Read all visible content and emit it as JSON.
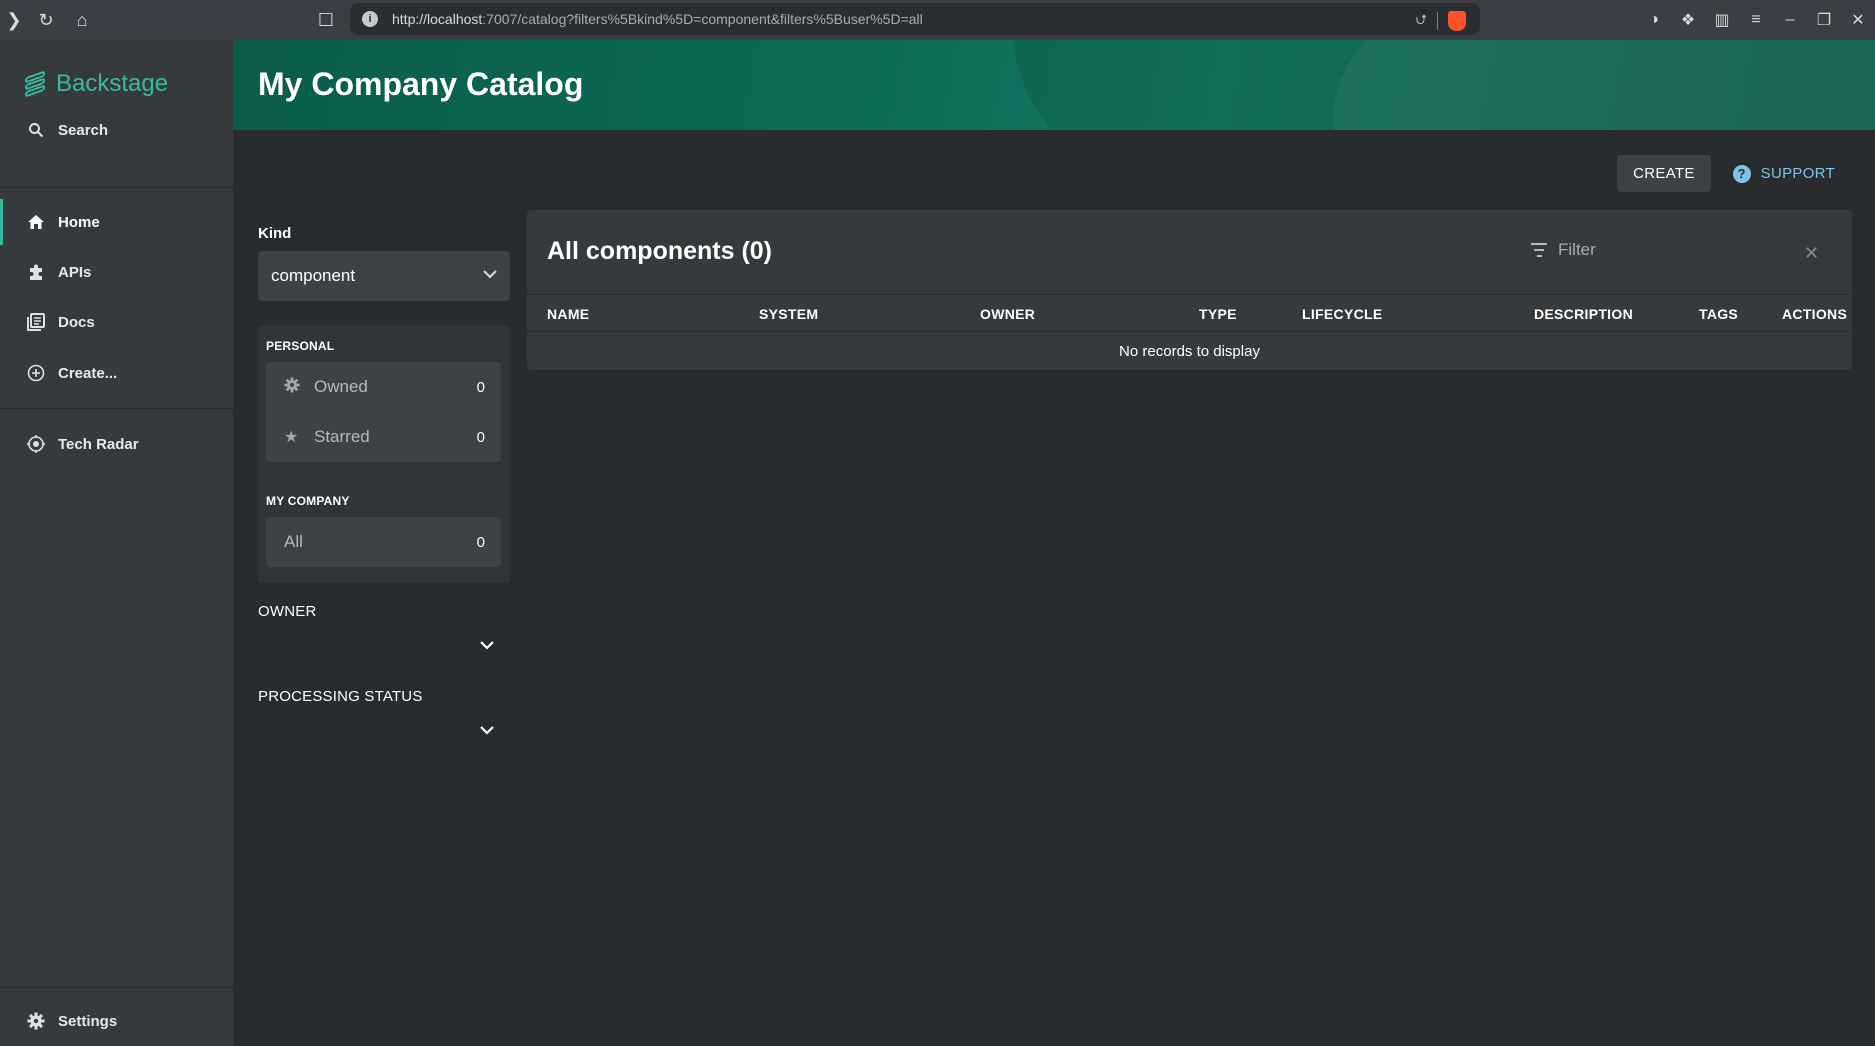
{
  "browser": {
    "url_host": "http://localhost",
    "url_rest": ":7007/catalog?filters%5Bkind%5D=component&filters%5Buser%5D=all"
  },
  "sidebar": {
    "logo": "Backstage",
    "items": [
      {
        "label": "Search",
        "icon": "search-icon"
      },
      {
        "label": "Home",
        "icon": "home-icon"
      },
      {
        "label": "APIs",
        "icon": "puzzle-icon"
      },
      {
        "label": "Docs",
        "icon": "docs-icon"
      },
      {
        "label": "Create...",
        "icon": "add-circle-icon"
      },
      {
        "label": "Tech Radar",
        "icon": "radar-icon"
      },
      {
        "label": "Settings",
        "icon": "gear-icon"
      }
    ]
  },
  "header": {
    "title": "My Company Catalog"
  },
  "actions": {
    "create": "CREATE",
    "support": "SUPPORT"
  },
  "filters": {
    "kind_label": "Kind",
    "kind_value": "component",
    "personal_title": "PERSONAL",
    "owned": {
      "label": "Owned",
      "count": "0"
    },
    "starred": {
      "label": "Starred",
      "count": "0"
    },
    "company_title": "MY COMPANY",
    "all": {
      "label": "All",
      "count": "0"
    },
    "owner_label": "OWNER",
    "processing_label": "PROCESSING STATUS"
  },
  "table": {
    "title": "All components (0)",
    "filter_placeholder": "Filter",
    "columns": [
      "NAME",
      "SYSTEM",
      "OWNER",
      "TYPE",
      "LIFECYCLE",
      "DESCRIPTION",
      "TAGS",
      "ACTIONS"
    ],
    "empty_message": "No records to display"
  },
  "colors": {
    "accent": "#36baa2",
    "header": "#0d6c58",
    "link": "#7ec3ea"
  }
}
